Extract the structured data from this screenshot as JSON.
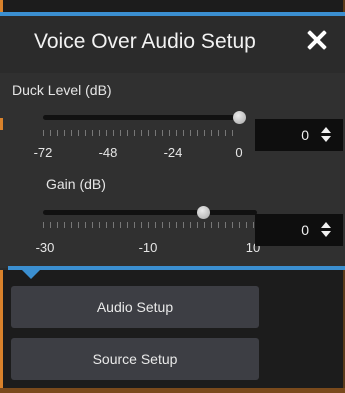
{
  "popup": {
    "title": "Voice Over Audio Setup",
    "close_icon": "close-icon"
  },
  "duck_level": {
    "label": "Duck Level (dB)",
    "ticks": [
      "-72",
      "-48",
      "-24",
      "0"
    ],
    "min": -72,
    "max": 0,
    "value": 0,
    "value_text": "0"
  },
  "gain": {
    "label": "Gain (dB)",
    "ticks": [
      "-30",
      "-10",
      "10"
    ],
    "min": -30,
    "max": 10,
    "value": 0,
    "value_text": "0"
  },
  "buttons": {
    "audio_setup": "Audio Setup",
    "source_setup": "Source Setup"
  },
  "colors": {
    "accent_blue": "#3b8fd0",
    "accent_orange": "#d9822b"
  }
}
